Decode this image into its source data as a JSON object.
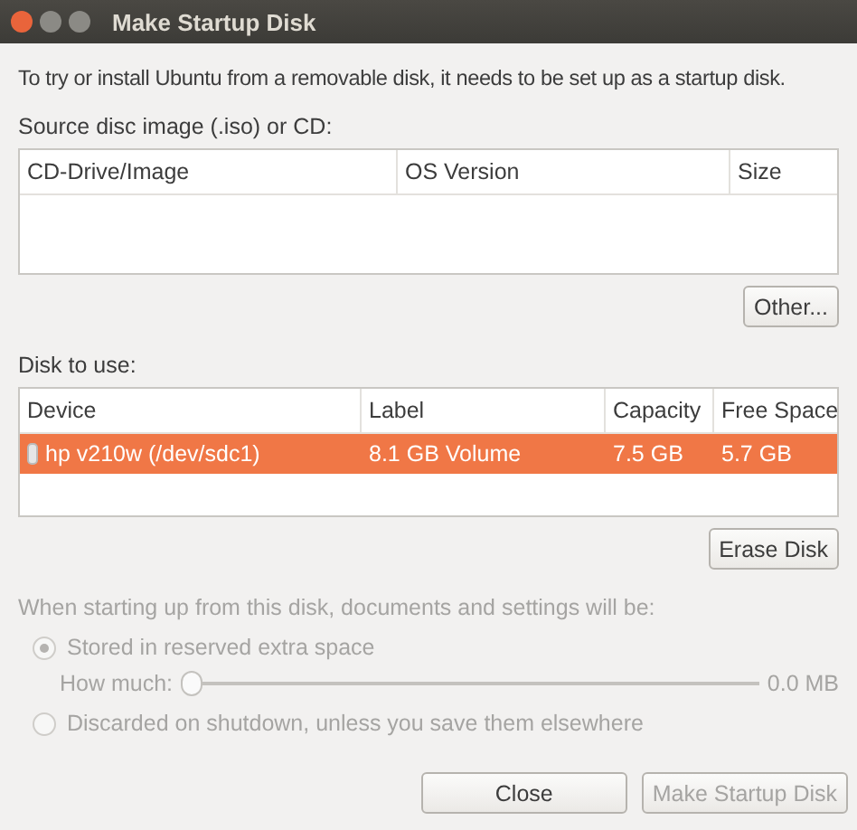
{
  "window": {
    "title": "Make Startup Disk"
  },
  "intro": "To try or install Ubuntu from a removable disk, it needs to be set up as a startup disk.",
  "source": {
    "label": "Source disc image (.iso) or CD:",
    "columns": [
      "CD-Drive/Image",
      "OS Version",
      "Size"
    ],
    "button": "Other..."
  },
  "disk": {
    "label": "Disk to use:",
    "columns": [
      "Device",
      "Label",
      "Capacity",
      "Free Space"
    ],
    "rows": [
      {
        "cells": [
          "hp v210w (/dev/sdc1)",
          "8.1 GB Volume",
          "7.5 GB",
          "5.7 GB"
        ],
        "selected": true
      }
    ],
    "button": "Erase Disk"
  },
  "persistence": {
    "label": "When starting up from this disk, documents and settings will be:",
    "disabled": true,
    "options": [
      {
        "label": "Stored in reserved extra space",
        "selected": true
      },
      {
        "label": "Discarded on shutdown, unless you save them elsewhere",
        "selected": false
      }
    ],
    "slider": {
      "label": "How much:",
      "level": 0,
      "reading": "0.0 MB"
    }
  },
  "buttons": [
    {
      "label": "Close",
      "disabled": false
    },
    {
      "label": "Make Startup Disk",
      "disabled": true
    }
  ]
}
